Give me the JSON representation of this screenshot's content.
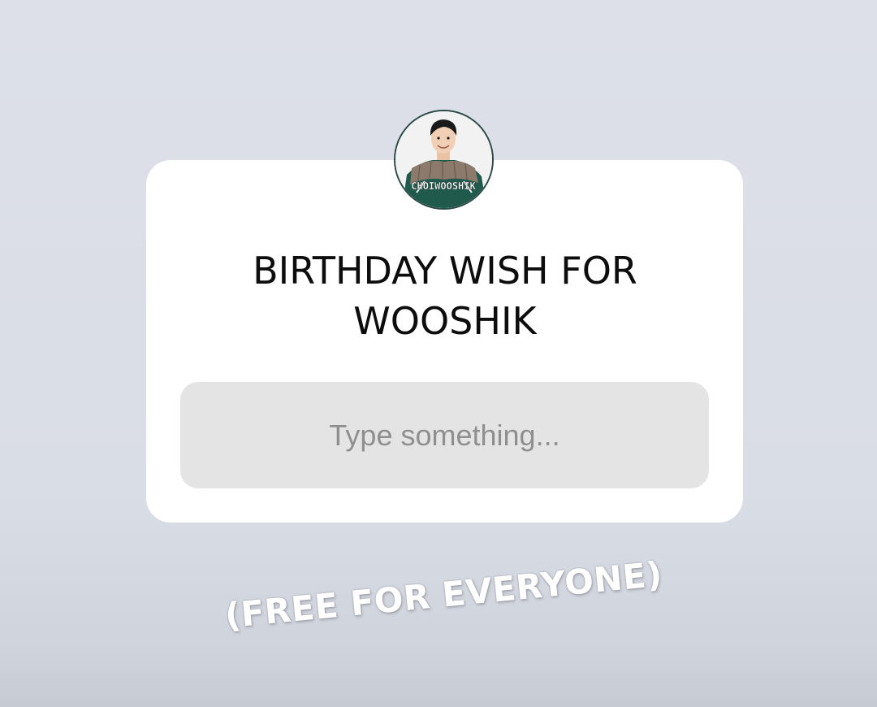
{
  "question_sticker": {
    "avatar_watermark": "CHOIWOOSHIK",
    "title_line1": "BIRTHDAY WISH FOR",
    "title_line2": "WOOSHIK",
    "input_placeholder": "Type something..."
  },
  "overlay_text": "(FREE FOR EVERYONE)",
  "colors": {
    "background": "#dde0e8",
    "card": "#ffffff",
    "input_background": "#e4e4e4",
    "placeholder": "#8f8f8f",
    "avatar_ring": "#2a4a45"
  }
}
